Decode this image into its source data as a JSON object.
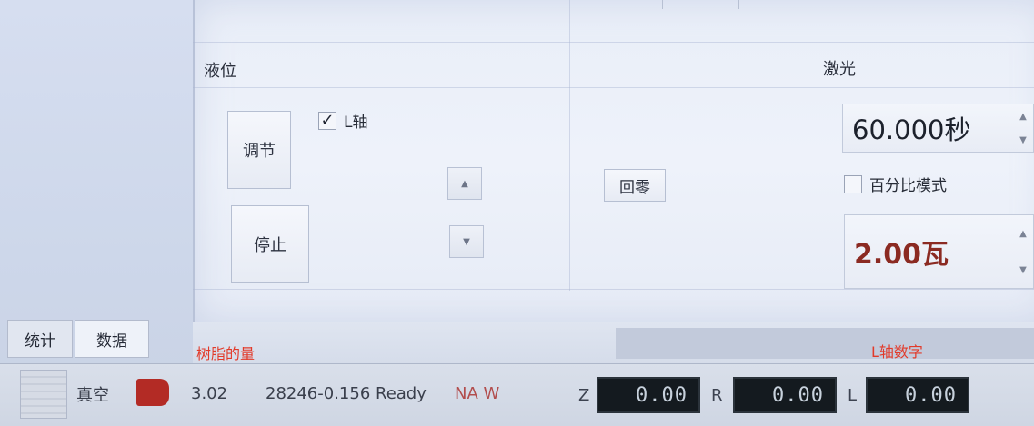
{
  "panel": {
    "liquid_level_label": "液位",
    "laser_label": "激光",
    "adjust_button": "调节",
    "stop_button": "停止",
    "l_axis_label": "L轴",
    "l_axis_checked": true,
    "zero_button": "回零",
    "time_value": "60.000秒",
    "percent_mode_label": "百分比模式",
    "power_value": "2.00瓦",
    "power_color": "#8b2a22"
  },
  "tabs": [
    {
      "label": "统计"
    },
    {
      "label": "数据"
    }
  ],
  "annotations": {
    "resin_amount": "树脂的量",
    "l_axis_number": "L轴数字",
    "color": "#e23a2a"
  },
  "status": {
    "vacuum_label": "真空",
    "resin_value": "3.02",
    "status_text": "28246-0.156 Ready",
    "na_w": "NA W",
    "z_label": "Z",
    "z_value": "0.00",
    "r_label": "R",
    "r_value": "0.00",
    "l_label": "L",
    "l_value": "0.00"
  }
}
